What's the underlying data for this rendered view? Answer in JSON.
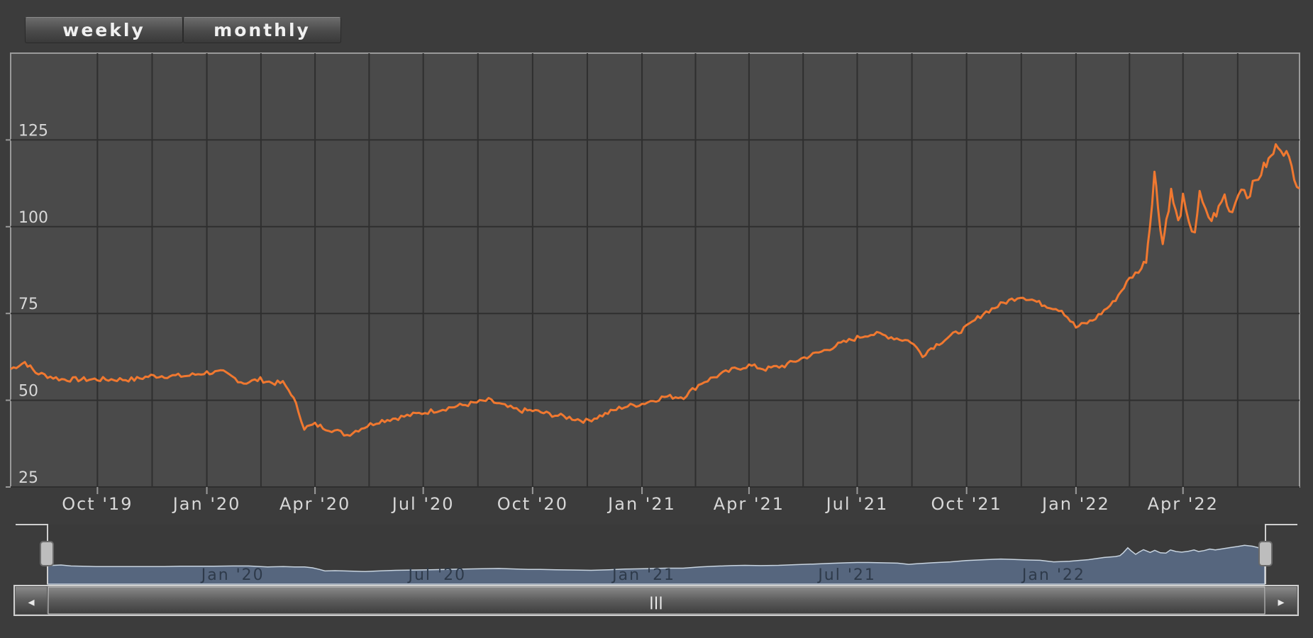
{
  "toolbar": {
    "weekly_label": "weekly",
    "monthly_label": "monthly"
  },
  "colors": {
    "line": "#f07830",
    "plot_bg": "#4a4a4a",
    "grid": "#2f2f2f",
    "navigator_fill": "#56667e",
    "navigator_line": "#c8d4e0"
  },
  "chart_data": {
    "type": "line",
    "title": "",
    "xlabel": "",
    "ylabel": "",
    "grid": true,
    "ylim": [
      25,
      150
    ],
    "xlim": [
      "2019-07-20",
      "2022-07-08"
    ],
    "y_ticks": [
      25,
      50,
      75,
      100,
      125
    ],
    "x_ticks": [
      {
        "date": "2019-10-01",
        "label": "Oct '19"
      },
      {
        "date": "2020-01-01",
        "label": "Jan '20"
      },
      {
        "date": "2020-04-01",
        "label": "Apr '20"
      },
      {
        "date": "2020-07-01",
        "label": "Jul '20"
      },
      {
        "date": "2020-10-01",
        "label": "Oct '20"
      },
      {
        "date": "2021-01-01",
        "label": "Jan '21"
      },
      {
        "date": "2021-04-01",
        "label": "Apr '21"
      },
      {
        "date": "2021-07-01",
        "label": "Jul '21"
      },
      {
        "date": "2021-10-01",
        "label": "Oct '21"
      },
      {
        "date": "2022-01-01",
        "label": "Jan '22"
      },
      {
        "date": "2022-04-01",
        "label": "Apr '22"
      }
    ],
    "series": [
      {
        "x": [
          "2019-07-20",
          "2019-08-01",
          "2019-08-10",
          "2019-08-20",
          "2019-09-01",
          "2019-09-15",
          "2019-10-01",
          "2019-10-15",
          "2019-11-01",
          "2019-11-15",
          "2019-12-01",
          "2019-12-15",
          "2020-01-01",
          "2020-01-15",
          "2020-02-01",
          "2020-02-15",
          "2020-02-25",
          "2020-03-05",
          "2020-03-12",
          "2020-03-18",
          "2020-03-23",
          "2020-04-01",
          "2020-04-10",
          "2020-04-20",
          "2020-04-28",
          "2020-05-10",
          "2020-05-25",
          "2020-06-10",
          "2020-06-25",
          "2020-07-10",
          "2020-07-25",
          "2020-08-10",
          "2020-08-25",
          "2020-09-10",
          "2020-09-20",
          "2020-10-01",
          "2020-10-15",
          "2020-11-01",
          "2020-11-15",
          "2020-12-01",
          "2020-12-15",
          "2021-01-01",
          "2021-01-20",
          "2021-02-05",
          "2021-02-20",
          "2021-03-05",
          "2021-03-20",
          "2021-04-01",
          "2021-04-15",
          "2021-05-01",
          "2021-05-15",
          "2021-06-01",
          "2021-06-15",
          "2021-07-01",
          "2021-07-10",
          "2021-07-20",
          "2021-08-01",
          "2021-08-15",
          "2021-08-25",
          "2021-09-01",
          "2021-09-15",
          "2021-10-01",
          "2021-10-15",
          "2021-11-01",
          "2021-11-15",
          "2021-11-25",
          "2021-12-01",
          "2021-12-10",
          "2021-12-20",
          "2022-01-01",
          "2022-01-15",
          "2022-02-01",
          "2022-02-15",
          "2022-02-25",
          "2022-03-01",
          "2022-03-04",
          "2022-03-08",
          "2022-03-11",
          "2022-03-15",
          "2022-03-18",
          "2022-03-22",
          "2022-03-28",
          "2022-04-01",
          "2022-04-06",
          "2022-04-11",
          "2022-04-15",
          "2022-04-20",
          "2022-04-25",
          "2022-05-01",
          "2022-05-06",
          "2022-05-10",
          "2022-05-15",
          "2022-05-20",
          "2022-05-25",
          "2022-06-01",
          "2022-06-08",
          "2022-06-14",
          "2022-06-20",
          "2022-06-27",
          "2022-07-08"
        ],
        "y": [
          59,
          61,
          58,
          57,
          56,
          56,
          56,
          56,
          56,
          57,
          57,
          57,
          58,
          58,
          55,
          56,
          55,
          55,
          52,
          47,
          42,
          43,
          42,
          41,
          40,
          42,
          44,
          45,
          46,
          47,
          48,
          49,
          50,
          48,
          47,
          47,
          46,
          45,
          44,
          46,
          48,
          49,
          51,
          51,
          55,
          57,
          59,
          60,
          59,
          60,
          62,
          64,
          66,
          68,
          69,
          69,
          68,
          67,
          63,
          65,
          68,
          71,
          75,
          78,
          80,
          79,
          78,
          77,
          76,
          71,
          73,
          78,
          85,
          88,
          91,
          100,
          116,
          106,
          95,
          102,
          110,
          101,
          108,
          100,
          99,
          109,
          104,
          102,
          105,
          109,
          104,
          107,
          112,
          109,
          113,
          117,
          120,
          124,
          121,
          111
        ]
      }
    ]
  },
  "navigator": {
    "labels": [
      {
        "date": "2020-01-01",
        "label": "Jan '20"
      },
      {
        "date": "2020-07-01",
        "label": "Jul '20"
      },
      {
        "date": "2021-01-01",
        "label": "Jan '21"
      },
      {
        "date": "2021-07-01",
        "label": "Jul '21"
      },
      {
        "date": "2022-01-01",
        "label": "Jan '22"
      }
    ],
    "handle_glyph": "|||",
    "left_arrow": "◂",
    "right_arrow": "▸"
  }
}
